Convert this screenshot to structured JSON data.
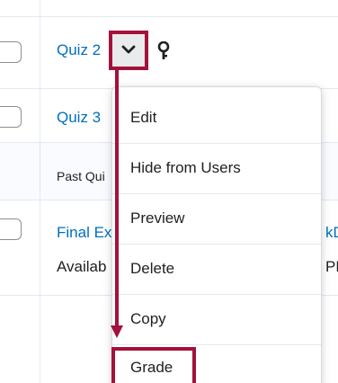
{
  "table": {
    "rows": [
      {
        "link": "Quiz 2"
      },
      {
        "link": "Quiz 3"
      },
      {
        "section_label": "Past Qui"
      },
      {
        "link": "Final Ex",
        "status": "Availab",
        "right_link": "kD",
        "right_text": "PM"
      }
    ]
  },
  "dropdown": {
    "button_icon": "chevron-down-icon",
    "restriction_icon": "key-icon"
  },
  "menu": {
    "items": [
      {
        "label": "Edit"
      },
      {
        "label": "Hide from Users"
      },
      {
        "label": "Preview"
      },
      {
        "label": "Delete"
      },
      {
        "label": "Copy"
      },
      {
        "label": "Grade"
      }
    ]
  },
  "annotation": {
    "highlight_color": "#a3123a"
  },
  "colors": {
    "link": "#006fbf",
    "text": "#202122",
    "border": "#e3e9f1"
  }
}
